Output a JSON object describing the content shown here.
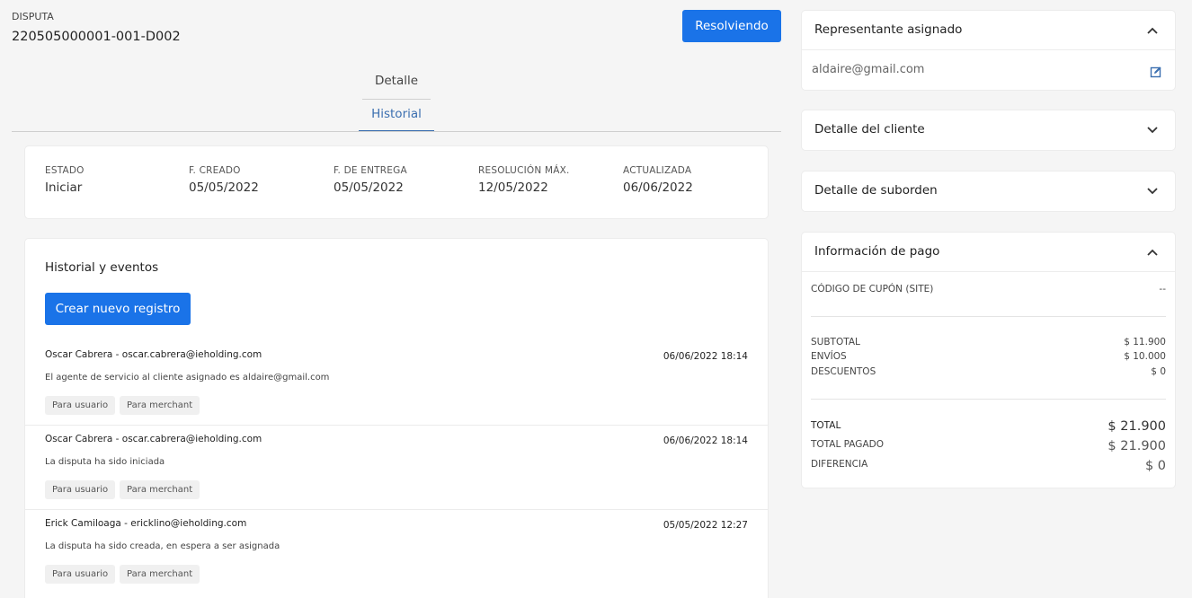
{
  "header": {
    "caption": "DISPUTA",
    "dispute_id": "220505000001-001-D002",
    "status_button": "Resolviendo"
  },
  "tabs": [
    {
      "label": "Detalle",
      "active": false
    },
    {
      "label": "Historial",
      "active": true
    }
  ],
  "summary": [
    {
      "label": "ESTADO",
      "value": "Iniciar"
    },
    {
      "label": "F. CREADO",
      "value": "05/05/2022"
    },
    {
      "label": "F. DE ENTREGA",
      "value": "05/05/2022"
    },
    {
      "label": "RESOLUCIÓN MÁX.",
      "value": "12/05/2022"
    },
    {
      "label": "ACTUALIZADA",
      "value": "06/06/2022"
    }
  ],
  "history": {
    "title": "Historial y eventos",
    "create_button": "Crear nuevo registro",
    "events": [
      {
        "author": "Oscar Cabrera - oscar.cabrera@ieholding.com",
        "date": "06/06/2022 18:14",
        "text": "El agente de servicio al cliente asignado es aldaire@gmail.com",
        "tags": [
          "Para usuario",
          "Para merchant"
        ]
      },
      {
        "author": "Oscar Cabrera - oscar.cabrera@ieholding.com",
        "date": "06/06/2022 18:14",
        "text": "La disputa ha sido iniciada",
        "tags": [
          "Para usuario",
          "Para merchant"
        ]
      },
      {
        "author": "Erick Camiloaga - ericklino@ieholding.com",
        "date": "05/05/2022 12:27",
        "text": "La disputa ha sido creada, en espera a ser asignada",
        "tags": [
          "Para usuario",
          "Para merchant"
        ]
      }
    ]
  },
  "sidebar": {
    "representative": {
      "title": "Representante asignado",
      "expanded": true,
      "email": "aldaire@gmail.com",
      "icons": {
        "toggle": "chevron-up-icon",
        "edit": "edit-icon"
      }
    },
    "client": {
      "title": "Detalle del cliente",
      "expanded": false,
      "icon": "chevron-down-icon"
    },
    "suborder": {
      "title": "Detalle de suborden",
      "expanded": false,
      "icon": "chevron-down-icon"
    },
    "payment": {
      "title": "Información de pago",
      "expanded": true,
      "icon": "chevron-up-icon",
      "coupon_label": "CÓDIGO DE CUPÓN (SITE)",
      "coupon_value": "--",
      "subtotal_label": "SUBTOTAL",
      "subtotal_value": "$ 11.900",
      "shipping_label": "ENVÍOS",
      "shipping_value": "$ 10.000",
      "discount_label": "DESCUENTOS",
      "discount_value": "$ 0",
      "total_label": "TOTAL",
      "total_value": "$ 21.900",
      "paid_label": "TOTAL PAGADO",
      "paid_value": "$ 21.900",
      "diff_label": "DIFERENCIA",
      "diff_value": "$ 0"
    }
  },
  "colors": {
    "primary": "#1a73e8",
    "tab_active": "#3b6fb0",
    "background": "#f5f5f5",
    "card": "#ffffff"
  }
}
